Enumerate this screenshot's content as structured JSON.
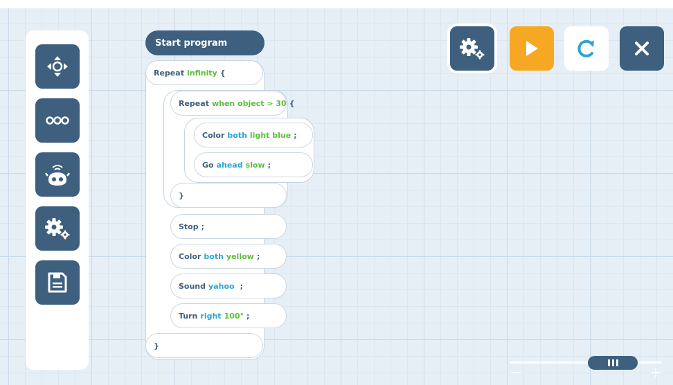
{
  "sidebar": {
    "items": [
      {
        "name": "direction-pad-icon"
      },
      {
        "name": "more-dots-icon"
      },
      {
        "name": "robot-wifi-icon"
      },
      {
        "name": "settings-gears-icon"
      },
      {
        "name": "save-floppy-icon"
      }
    ]
  },
  "program": {
    "start_label": "Start program",
    "outer_repeat": {
      "keyword": "Repeat",
      "value": "infinity",
      "open": "{"
    },
    "inner_repeat": {
      "keyword": "Repeat",
      "value": "when object > 30",
      "open": "{"
    },
    "inner_lines": [
      {
        "keyword": "Color",
        "v1": "both",
        "v2": "light blue",
        "end": ";"
      },
      {
        "keyword": "Go",
        "v1": "ahead",
        "v2": "slow",
        "end": ";"
      }
    ],
    "inner_close": "}",
    "lines": [
      {
        "keyword": "Stop",
        "v1": "",
        "v2": "",
        "end": ";"
      },
      {
        "keyword": "Color",
        "v1": "both",
        "v2": "yellow",
        "end": ";"
      },
      {
        "keyword": "Sound",
        "v1": "yahoo",
        "v2": "",
        "end": ";"
      },
      {
        "keyword": "Turn",
        "v1": "right",
        "v2": "100°",
        "end": ";"
      }
    ],
    "outer_close": "}"
  },
  "toolbar": {
    "settings_color": "#3e5f7e",
    "play_color": "#f7a823",
    "reload_color": "#ffffff",
    "close_color": "#3e5f7e"
  },
  "zoom": {
    "minus": "−",
    "plus": "+"
  },
  "colors": {
    "primary": "#3e5f7e",
    "accent_blue": "#2aa5d6",
    "accent_green": "#5bbf3b",
    "accent_orange": "#f7a823"
  }
}
